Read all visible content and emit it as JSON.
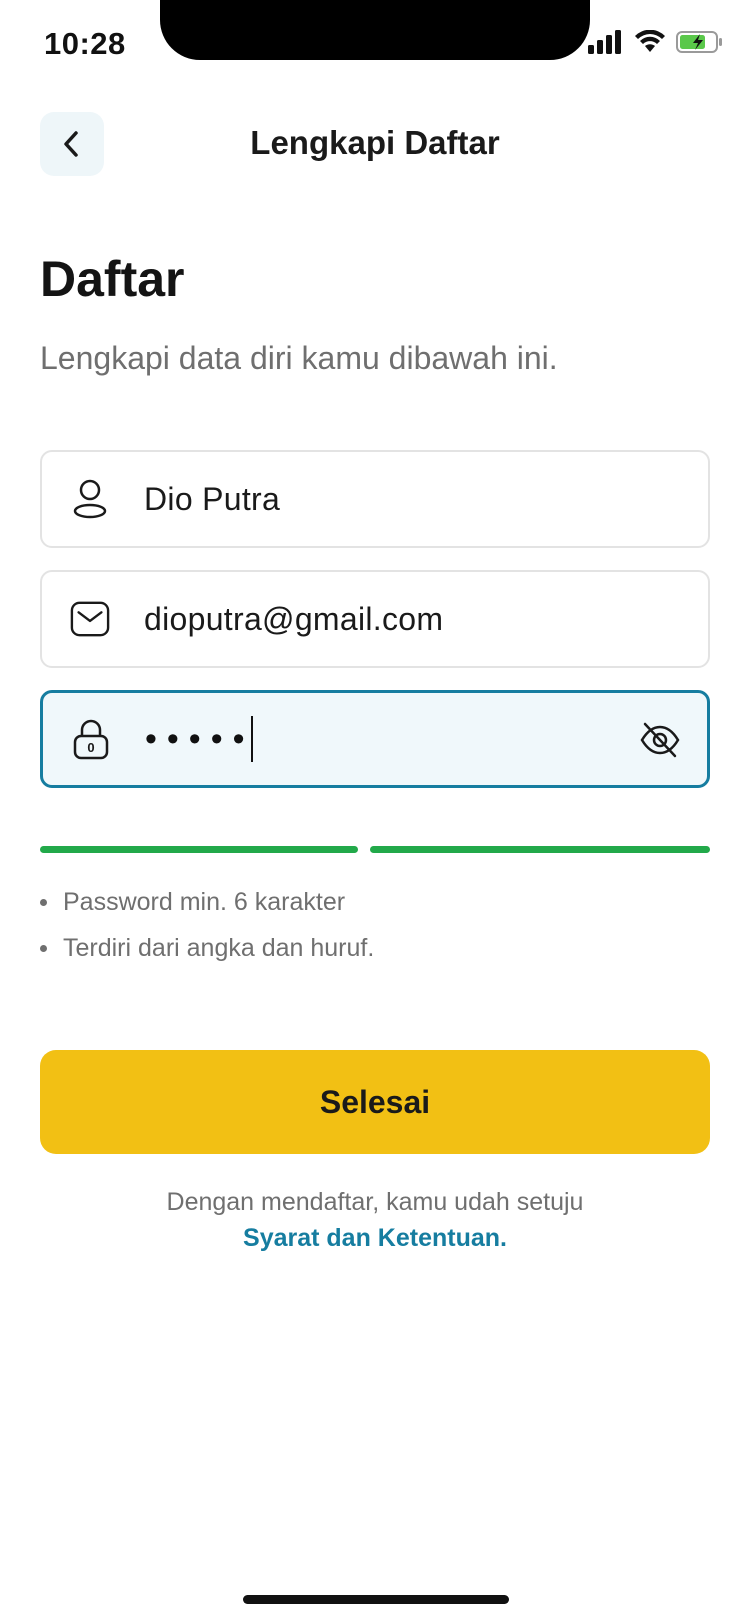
{
  "status_bar": {
    "time": "10:28",
    "icons": [
      "signal-icon",
      "wifi-icon",
      "battery-charging-icon"
    ]
  },
  "header": {
    "title": "Lengkapi Daftar",
    "back_icon": "chevron-left-icon"
  },
  "page": {
    "heading": "Daftar",
    "subtitle": "Lengkapi data diri kamu dibawah ini."
  },
  "form": {
    "name": {
      "value": "Dio Putra",
      "icon": "user-icon"
    },
    "email": {
      "value": "dioputra@gmail.com",
      "icon": "mail-icon"
    },
    "password": {
      "masked_value": "•••••",
      "icon": "lock-icon",
      "lock_label": "0",
      "toggle_icon": "eye-off-icon"
    },
    "strength_segments_filled": 2,
    "strength_segments_total": 2,
    "hints": [
      "Password min. 6 karakter",
      "Terdiri dari angka dan huruf."
    ]
  },
  "actions": {
    "submit_label": "Selesai",
    "terms_text": "Dengan mendaftar, kamu udah setuju",
    "terms_link": "Syarat dan Ketentuan."
  },
  "colors": {
    "accent": "#167da0",
    "button": "#f2c014",
    "strength": "#22a94a",
    "input_active_bg": "#f0f8fb"
  }
}
